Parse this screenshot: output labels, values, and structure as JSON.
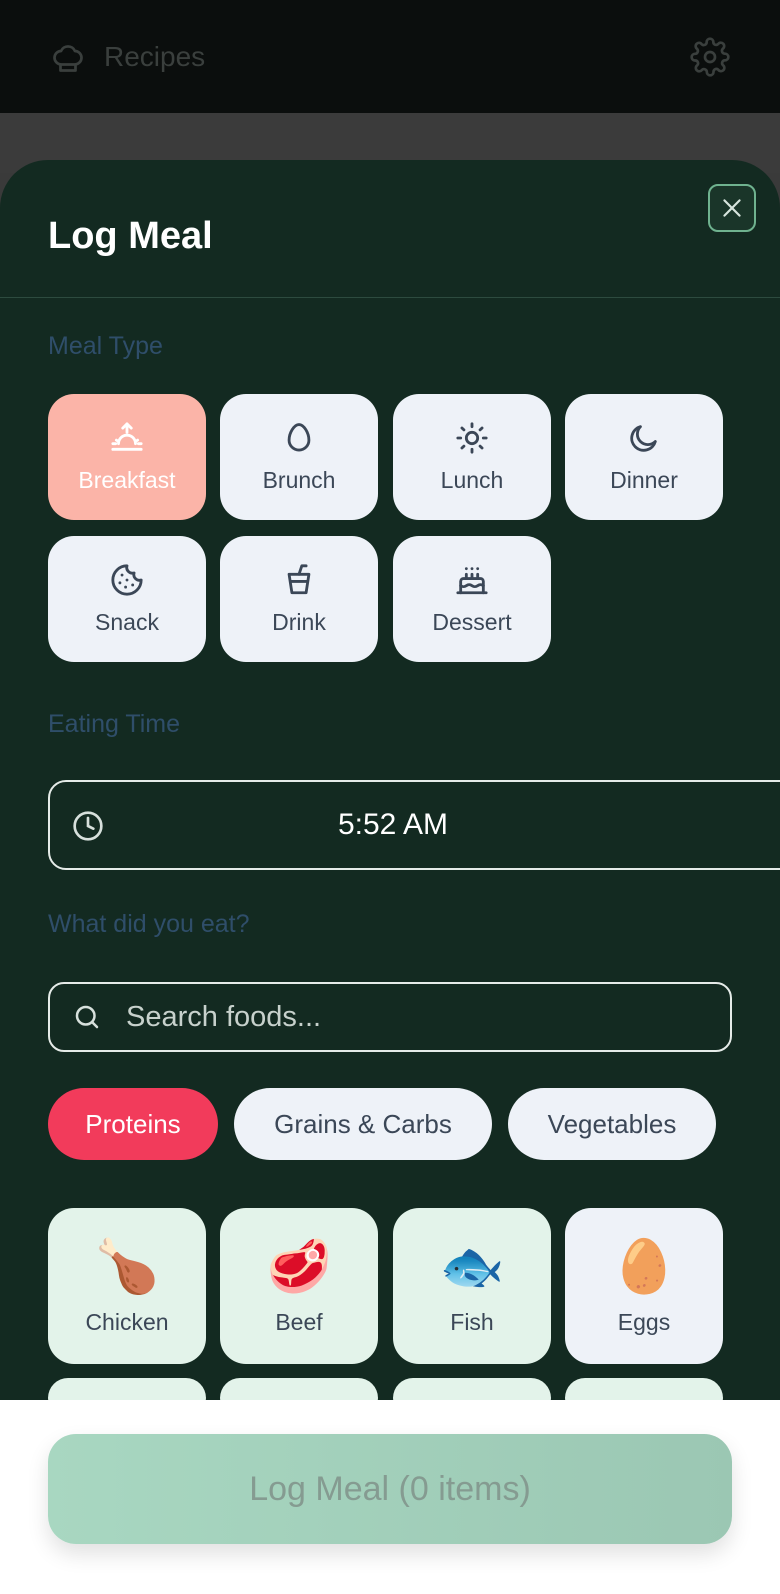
{
  "app_bar": {
    "title": "Recipes"
  },
  "sheet": {
    "title": "Log Meal",
    "meal_type_label": "Meal Type",
    "meal_types": [
      {
        "label": "Breakfast",
        "icon": "sunrise-icon",
        "selected": true
      },
      {
        "label": "Brunch",
        "icon": "egg-icon",
        "selected": false
      },
      {
        "label": "Lunch",
        "icon": "sun-icon",
        "selected": false
      },
      {
        "label": "Dinner",
        "icon": "moon-icon",
        "selected": false
      },
      {
        "label": "Snack",
        "icon": "cookie-icon",
        "selected": false
      },
      {
        "label": "Drink",
        "icon": "cup-icon",
        "selected": false
      },
      {
        "label": "Dessert",
        "icon": "cake-icon",
        "selected": false
      }
    ],
    "eating_time_label": "Eating Time",
    "eating_time_value": "5:52 AM",
    "what_label": "What did you eat?",
    "search_placeholder": "Search foods...",
    "categories": [
      {
        "label": "Proteins",
        "selected": true
      },
      {
        "label": "Grains & Carbs",
        "selected": false
      },
      {
        "label": "Vegetables",
        "selected": false
      }
    ],
    "foods": [
      {
        "label": "Chicken",
        "emoji": "🍗"
      },
      {
        "label": "Beef",
        "emoji": "🥩"
      },
      {
        "label": "Fish",
        "emoji": "🐟"
      },
      {
        "label": "Eggs",
        "emoji": "🥚"
      }
    ]
  },
  "action": {
    "log_button": "Log Meal (0 items)"
  },
  "colors": {
    "sheet_bg": "#132a21",
    "selected_meal": "#fbb4a8",
    "selected_chip": "#f23b5b",
    "log_button": "#a8d7c1"
  }
}
